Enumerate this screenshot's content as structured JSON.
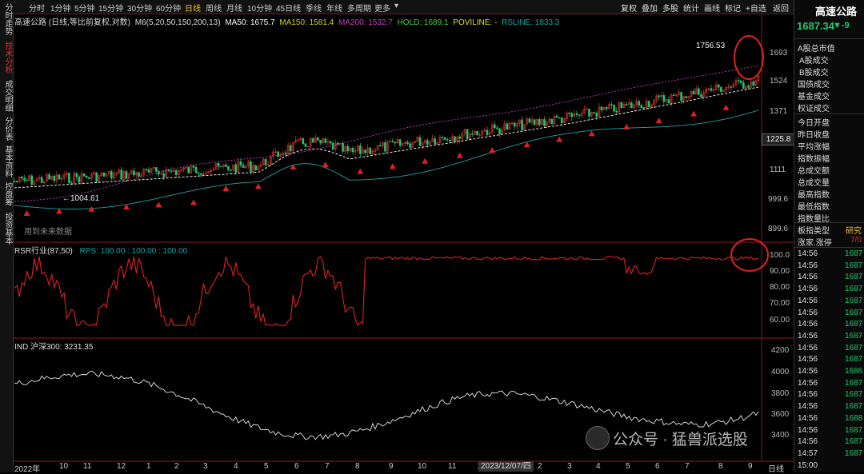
{
  "sidebar": {
    "tabs": [
      {
        "label": "分时走势",
        "active": false
      },
      {
        "label": "技术分析",
        "active": true
      },
      {
        "label": "成交明细",
        "active": false
      },
      {
        "label": "分价表",
        "active": false
      },
      {
        "label": "基本资料",
        "active": false
      },
      {
        "label": "控盘筹",
        "active": false
      },
      {
        "label": "投资基本",
        "active": false
      }
    ]
  },
  "toolbar": {
    "periods": [
      "分时",
      "1分钟",
      "5分钟",
      "15分钟",
      "30分钟",
      "60分钟",
      "日线",
      "周线",
      "月线",
      "10分钟",
      "45日线",
      "季线",
      "年线",
      "多周期",
      "更多"
    ],
    "active_period": "日线",
    "buttons": [
      "复权",
      "叠加",
      "多股",
      "统计",
      "画线",
      "标记",
      "+自选",
      "返回"
    ]
  },
  "legend": {
    "name": "高速公路 (日线,等比前复权,对数)",
    "ma_params": "M6(5,20,50,150,200,13)",
    "ma50": "MA50: 1675.7",
    "ma150": "MA150: 1581.4",
    "ma200": "MA200: 1532.7",
    "hold": "HOLD: 1689.1",
    "poviline": "POVILINE: -",
    "rsline": "RSLINE: 1833.3"
  },
  "main_axis": [
    "1693",
    "1524",
    "1371",
    "1225.8",
    "1111",
    "999.6",
    "899.6"
  ],
  "annotations": {
    "high": "1756.53",
    "low": "1004.61",
    "future": "用到未来数据"
  },
  "rsr": {
    "label": "RSR行业(87,50)",
    "rps": "RPS: 100.00 : 100.00 : 100.00",
    "axis": [
      "100.0",
      "90.00",
      "80.00",
      "70.00",
      "60.00"
    ]
  },
  "ind": {
    "label": "IND 沪深300: 3231.35",
    "axis": [
      "4200",
      "4000",
      "3800",
      "3600",
      "3400"
    ]
  },
  "xaxis": {
    "labels": [
      "2022年",
      "10",
      "11",
      "12",
      "1",
      "2",
      "3",
      "4",
      "5",
      "6",
      "7",
      "8",
      "9",
      "10",
      "11",
      "1",
      "2",
      "3",
      "4",
      "5",
      "6",
      "7",
      "8",
      "9"
    ],
    "date_box": "2023/12/07/四",
    "period": "日线"
  },
  "right_panel": {
    "title": "高速公路",
    "price": "1687.34",
    "change": "▼-9",
    "rows": [
      "A股总市值",
      "A股成交",
      "B股成交",
      "国债成交",
      "基金成交",
      "权证成交",
      "今日开盘",
      "昨日收盘",
      "平均涨幅",
      "指数振幅",
      "总成交额",
      "总成交量",
      "最高指数",
      "最低指数",
      "指数量比",
      "板指类型",
      "涨家.涨停"
    ],
    "board_type": "研究",
    "zt": "7/0",
    "ticks_time": "14:56",
    "ticks": [
      "1687",
      "1687",
      "1687",
      "1687",
      "1687",
      "1687",
      "1687",
      "1687",
      "1687",
      "1687",
      "1686",
      "1687",
      "1687",
      "1687",
      "1688",
      "1687",
      "1687",
      "1687"
    ],
    "last_time": "14:57",
    "close_time": "15:00"
  },
  "watermark": "公众号 · 猛兽派选股",
  "colors": {
    "up": "#e03030",
    "down": "#1ec870",
    "ma50": "#ffffff",
    "ma150": "#d0d020",
    "ma200": "#c040c0",
    "hold": "#40d040",
    "rsline": "#20a0a0"
  }
}
